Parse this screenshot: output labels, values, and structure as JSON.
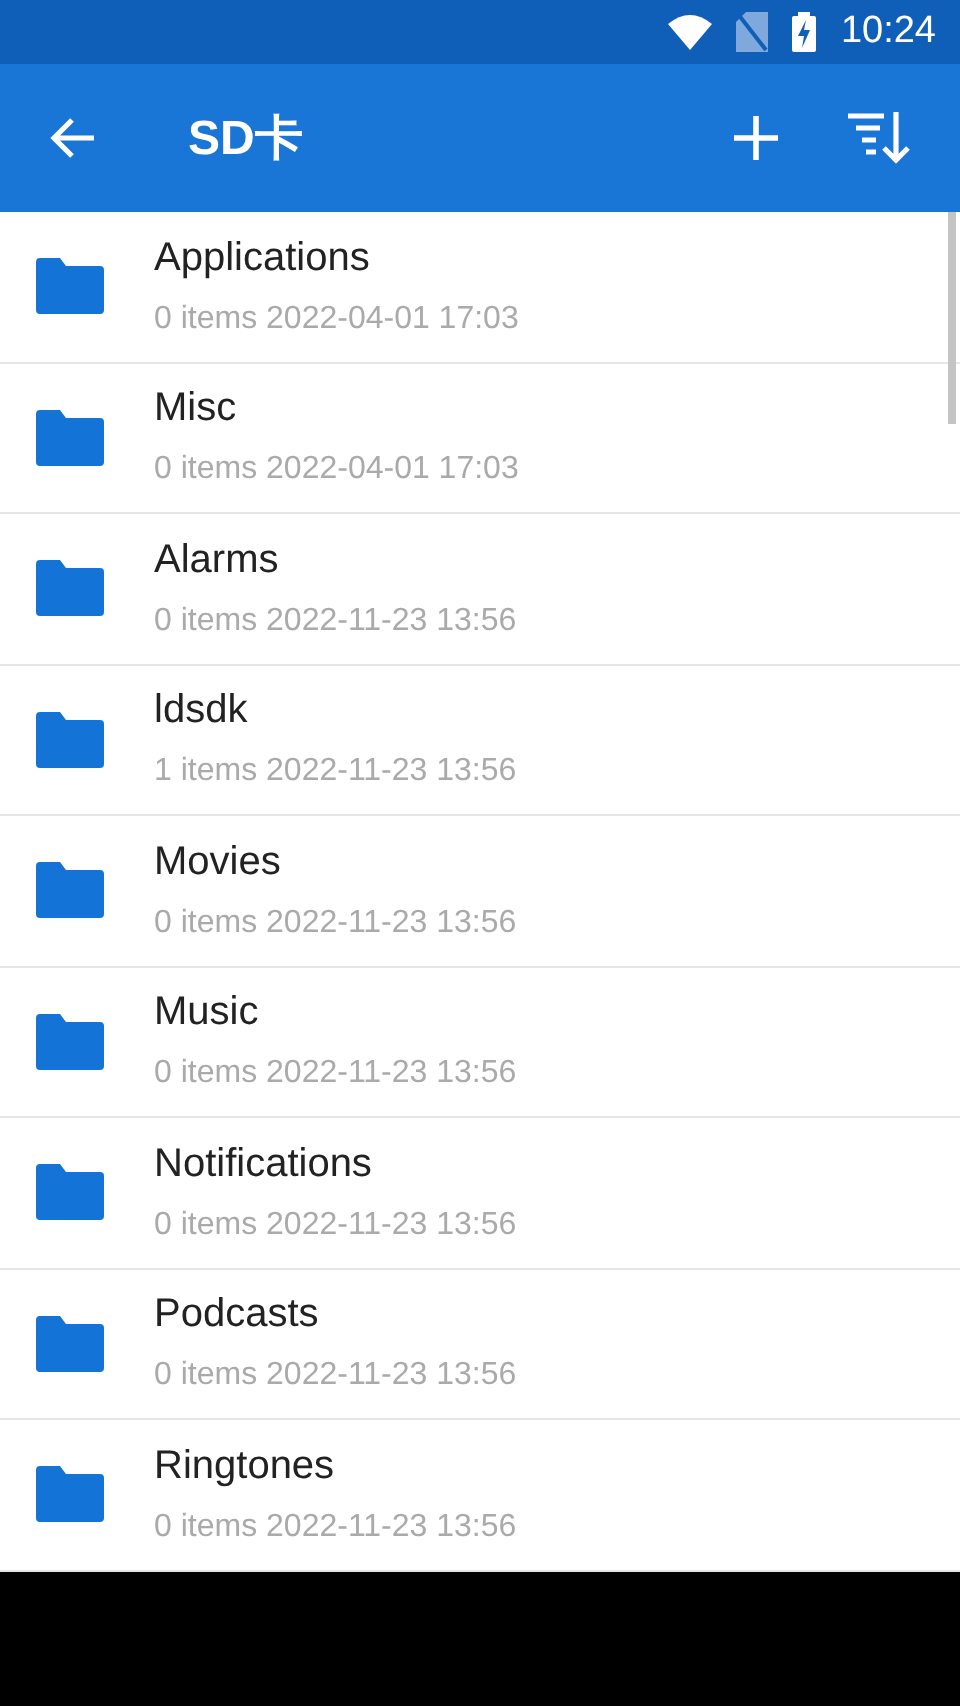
{
  "status_bar": {
    "time": "10:24"
  },
  "toolbar": {
    "title": "SD卡"
  },
  "files": [
    {
      "name": "Applications",
      "details": "0 items 2022-04-01 17:03"
    },
    {
      "name": "Misc",
      "details": "0 items 2022-04-01 17:03"
    },
    {
      "name": "Alarms",
      "details": "0 items 2022-11-23 13:56"
    },
    {
      "name": "ldsdk",
      "details": "1 items 2022-11-23 13:56"
    },
    {
      "name": "Movies",
      "details": "0 items 2022-11-23 13:56"
    },
    {
      "name": "Music",
      "details": "0 items 2022-11-23 13:56"
    },
    {
      "name": "Notifications",
      "details": "0 items 2022-11-23 13:56"
    },
    {
      "name": "Podcasts",
      "details": "0 items 2022-11-23 13:56"
    },
    {
      "name": "Ringtones",
      "details": "0 items 2022-11-23 13:56"
    }
  ]
}
